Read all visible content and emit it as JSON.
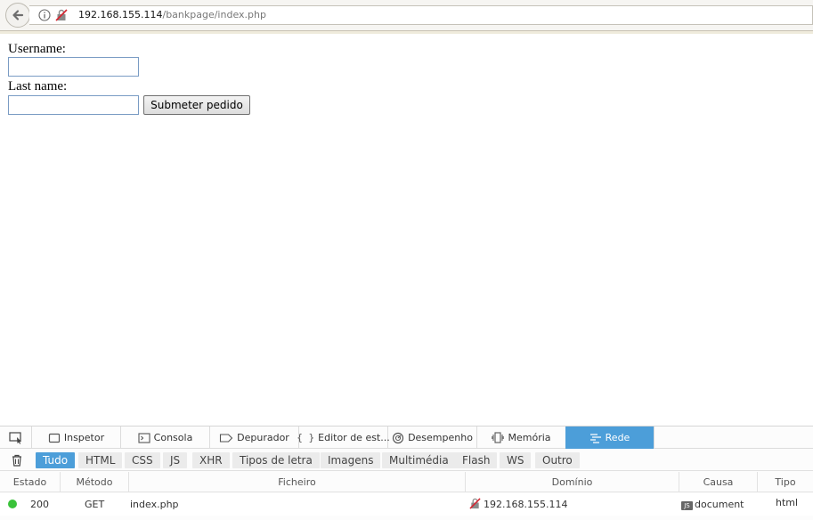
{
  "browser": {
    "url_host": "192.168.155.114",
    "url_path": "/bankpage/index.php",
    "icons": {
      "back": "back-arrow-icon",
      "info": "info-icon",
      "insecure": "insecure-connection-icon"
    }
  },
  "form": {
    "username_label": "Username:",
    "username_value": "",
    "lastname_label": "Last name:",
    "lastname_value": "",
    "submit_label": "Submeter pedido"
  },
  "devtools": {
    "tabs": [
      {
        "label": "Inspetor",
        "icon": "inspector-icon"
      },
      {
        "label": "Consola",
        "icon": "console-icon"
      },
      {
        "label": "Depurador",
        "icon": "debugger-icon"
      },
      {
        "label": "Editor de est...",
        "icon": "style-editor-icon"
      },
      {
        "label": "Desempenho",
        "icon": "performance-icon"
      },
      {
        "label": "Memória",
        "icon": "memory-icon"
      },
      {
        "label": "Rede",
        "icon": "network-icon",
        "active": true
      }
    ],
    "filters": [
      "Tudo",
      "HTML",
      "CSS",
      "JS",
      "XHR",
      "Tipos de letra",
      "Imagens",
      "Multimédia",
      "Flash",
      "WS",
      "Outro"
    ],
    "active_filter": "Tudo",
    "columns": [
      "Estado",
      "Método",
      "Ficheiro",
      "Domínio",
      "Causa",
      "Tipo"
    ],
    "requests": [
      {
        "status": "200",
        "method": "GET",
        "file": "index.php",
        "domain": "192.168.155.114",
        "cause_badge": "JS",
        "cause": "document",
        "type": "html"
      }
    ],
    "colors": {
      "accent": "#4c9ed9",
      "status_ok": "#3ac23a"
    }
  }
}
